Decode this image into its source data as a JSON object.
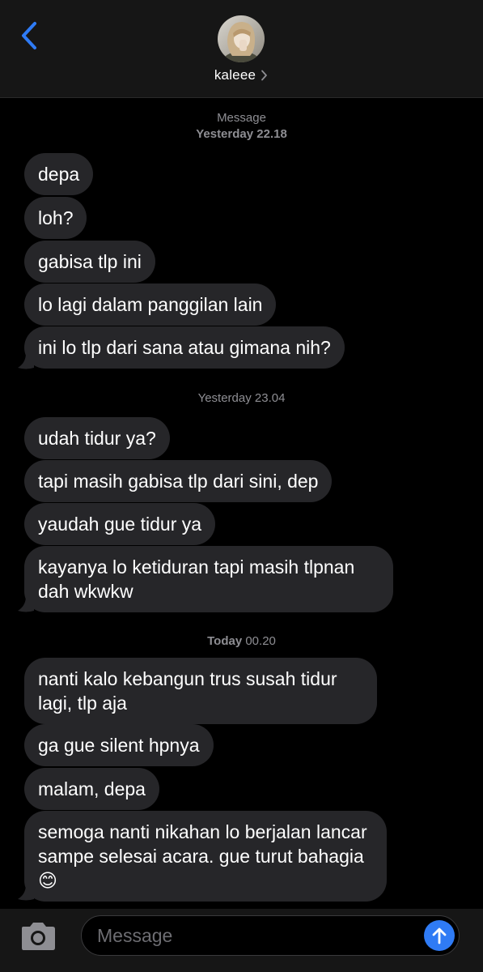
{
  "header": {
    "back_icon": "chevron-left-icon",
    "contact_name": "kaleee",
    "contact_chevron_icon": "chevron-right-icon",
    "accent_color": "#2f7bf5"
  },
  "timestamps": [
    {
      "label": "Message",
      "time_bold": "",
      "time": "Yesterday 22.18"
    },
    {
      "label": "",
      "time_bold": "",
      "time": "Yesterday 23.04"
    },
    {
      "label": "",
      "time_bold": "Today",
      "time": " 00.20"
    }
  ],
  "messages": [
    {
      "text": "depa"
    },
    {
      "text": "loh?"
    },
    {
      "text": "gabisa tlp ini"
    },
    {
      "text": "lo lagi dalam panggilan lain"
    },
    {
      "text": "ini lo tlp dari sana atau gimana nih?"
    },
    {
      "text": "udah tidur ya?"
    },
    {
      "text": "tapi masih gabisa tlp dari sini, dep"
    },
    {
      "text": "yaudah gue tidur ya"
    },
    {
      "text": "kayanya lo ketiduran tapi masih tlpnan dah wkwkw"
    },
    {
      "text": "nanti kalo kebangun trus susah tidur lagi, tlp aja"
    },
    {
      "text": "ga gue silent hpnya"
    },
    {
      "text": "malam, depa"
    },
    {
      "text": "semoga nanti nikahan lo berjalan lancar sampe selesai acara. gue turut bahagia",
      "emoji": "😊"
    }
  ],
  "composer": {
    "camera_icon": "camera-icon",
    "placeholder": "Message",
    "send_icon": "arrow-up-icon"
  },
  "colors": {
    "background": "#000000",
    "bar": "#161616",
    "bubble": "#262629",
    "timestamp": "#8e8e93"
  }
}
